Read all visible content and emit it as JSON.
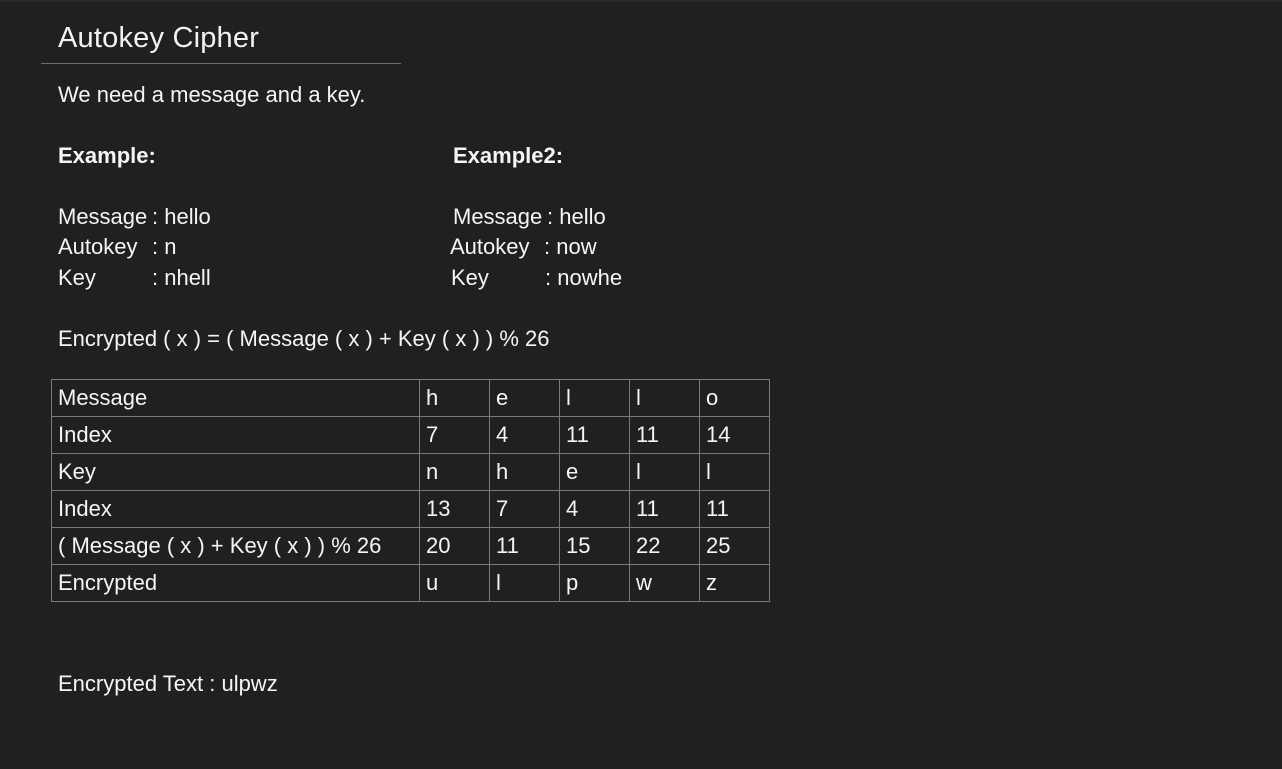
{
  "title": "Autokey Cipher",
  "intro": "We need a message and a key.",
  "example1": {
    "heading": "Example:",
    "message_label": "Message",
    "message_value": ": hello",
    "autokey_label": "Autokey",
    "autokey_value": ": n",
    "key_label": "Key",
    "key_value": ": nhell"
  },
  "example2": {
    "heading": "Example2:",
    "message_label": "Message",
    "message_value": ": hello",
    "autokey_label": "Autokey",
    "autokey_value": ": now",
    "key_label": "Key",
    "key_value": ": nowhe"
  },
  "formula": "Encrypted ( x ) = ( Message ( x ) + Key ( x ) ) % 26",
  "table": {
    "rows": [
      {
        "label": "Message",
        "cells": [
          "h",
          "e",
          "l",
          "l",
          "o"
        ]
      },
      {
        "label": "Index",
        "cells": [
          "7",
          "4",
          "11",
          "11",
          "14"
        ]
      },
      {
        "label": "Key",
        "cells": [
          "n",
          "h",
          "e",
          "l",
          "l"
        ]
      },
      {
        "label": "Index",
        "cells": [
          "13",
          "7",
          "4",
          "11",
          "11"
        ]
      },
      {
        "label": "( Message ( x ) + Key ( x ) ) % 26",
        "cells": [
          "20",
          "11",
          "15",
          "22",
          "25"
        ]
      },
      {
        "label": "Encrypted",
        "cells": [
          "u",
          "l",
          "p",
          "w",
          "z"
        ]
      }
    ]
  },
  "result": "Encrypted Text : ulpwz"
}
